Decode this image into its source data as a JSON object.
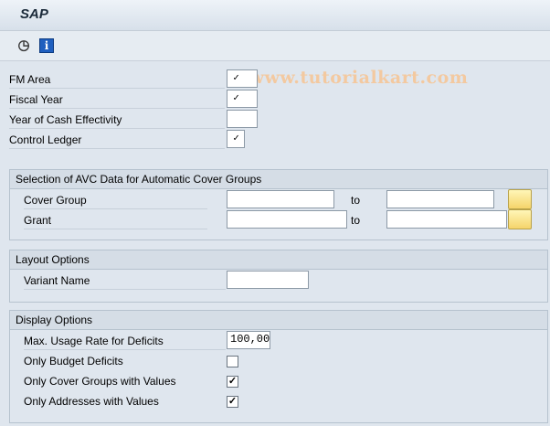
{
  "window": {
    "title": "SAP"
  },
  "toolbar": {
    "watermark": "© www.tutorialkart.com"
  },
  "top_fields": [
    {
      "label": "FM Area",
      "value": "✓"
    },
    {
      "label": "Fiscal Year",
      "value": "✓"
    },
    {
      "label": "Year of Cash Effectivity",
      "value": ""
    },
    {
      "label": "Control Ledger",
      "value": "✓"
    }
  ],
  "avc": {
    "title": "Selection of AVC Data for Automatic Cover Groups",
    "rows": [
      {
        "label": "Cover Group",
        "from": "",
        "to_label": "to",
        "to": ""
      },
      {
        "label": "Grant",
        "from": "",
        "to_label": "to",
        "to": ""
      }
    ]
  },
  "layout": {
    "title": "Layout Options",
    "variant_label": "Variant Name",
    "variant_value": ""
  },
  "display": {
    "title": "Display Options",
    "max_usage_label": "Max. Usage Rate for Deficits",
    "max_usage_value": "100,00",
    "checkboxes": [
      {
        "label": "Only Budget Deficits",
        "value": ""
      },
      {
        "label": "Only Cover Groups with Values",
        "value": "✓"
      },
      {
        "label": "Only Addresses with Values",
        "value": "✓"
      }
    ]
  }
}
